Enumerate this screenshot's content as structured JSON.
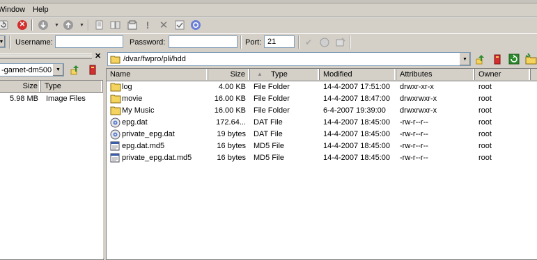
{
  "menu": {
    "window": "Window",
    "help": "Help"
  },
  "toolbar": {
    "icons": [
      "refresh-icon",
      "stop-icon",
      "download-icon",
      "upload-icon",
      "edit-icon",
      "view-icon",
      "properties-icon",
      "attention-icon",
      "delete-icon",
      "checklist-icon",
      "settings-icon"
    ]
  },
  "connection": {
    "username_label": "Username:",
    "username_value": "",
    "password_label": "Password:",
    "password_value": "",
    "port_label": "Port:",
    "port_value": "21"
  },
  "left_pane": {
    "combo_value": "-garnet-dm500-",
    "columns": {
      "size": "Size",
      "type": "Type"
    },
    "rows": [
      {
        "size": "5.98 MB",
        "type": "Image Files"
      }
    ]
  },
  "right_pane": {
    "path": "/dvar/fwpro/pli/hdd",
    "columns": {
      "name": "Name",
      "size": "Size",
      "type": "Type",
      "modified": "Modified",
      "attributes": "Attributes",
      "owner": "Owner"
    },
    "files": [
      {
        "icon": "folder",
        "name": "log",
        "size": "4.00 KB",
        "type": "File Folder",
        "modified": "14-4-2007 17:51:00",
        "attributes": "drwxr-xr-x",
        "owner": "root"
      },
      {
        "icon": "folder",
        "name": "movie",
        "size": "16.00 KB",
        "type": "File Folder",
        "modified": "14-4-2007 18:47:00",
        "attributes": "drwxrwxr-x",
        "owner": "root"
      },
      {
        "icon": "folder",
        "name": "My Music",
        "size": "16.00 KB",
        "type": "File Folder",
        "modified": "6-4-2007 19:39:00",
        "attributes": "drwxrwxr-x",
        "owner": "root"
      },
      {
        "icon": "dat",
        "name": "epg.dat",
        "size": "172.64...",
        "type": "DAT File",
        "modified": "14-4-2007 18:45:00",
        "attributes": "-rw-r--r--",
        "owner": "root"
      },
      {
        "icon": "dat",
        "name": "private_epg.dat",
        "size": "19 bytes",
        "type": "DAT File",
        "modified": "14-4-2007 18:45:00",
        "attributes": "-rw-r--r--",
        "owner": "root"
      },
      {
        "icon": "md5",
        "name": "epg.dat.md5",
        "size": "16 bytes",
        "type": "MD5 File",
        "modified": "14-4-2007 18:45:00",
        "attributes": "-rw-r--r--",
        "owner": "root"
      },
      {
        "icon": "md5",
        "name": "private_epg.dat.md5",
        "size": "16 bytes",
        "type": "MD5 File",
        "modified": "14-4-2007 18:45:00",
        "attributes": "-rw-r--r--",
        "owner": "root"
      }
    ]
  },
  "colors": {
    "folder": "#f4d35e",
    "stop": "#d32f2f",
    "up_arrow": "#2e8b2e"
  }
}
